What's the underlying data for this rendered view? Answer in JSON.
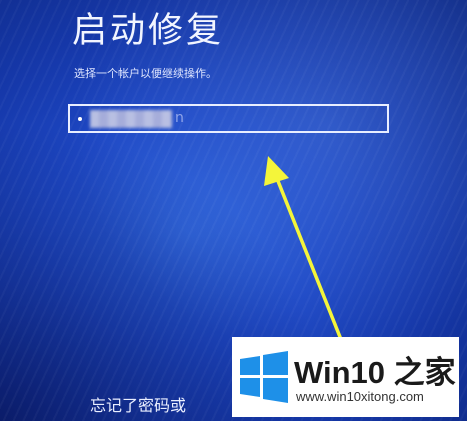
{
  "screen": {
    "title": "启动修复",
    "subtitle": "选择一个帐户以便继续操作。",
    "account_field": {
      "visible_suffix": "n"
    },
    "forgot_password_link": "忘记了密码或"
  },
  "watermark": {
    "brand": "Win10 之家",
    "url": "www.win10xitong.com"
  },
  "colors": {
    "background": "#1d47c4",
    "arrow": "#f4f53a",
    "text": "#f2f5ff",
    "logo_blue": "#1e90e8"
  },
  "icons": {
    "annotation": "arrow-icon",
    "logo": "windows-logo-icon"
  }
}
